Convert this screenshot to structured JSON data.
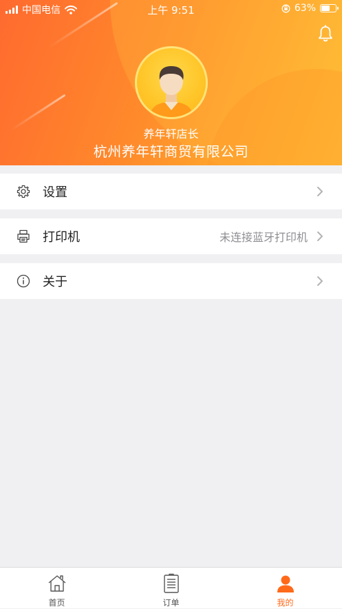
{
  "status_bar": {
    "carrier": "中国电信",
    "time": "上午 9:51",
    "battery": "63%",
    "battery_level": 0.63
  },
  "profile": {
    "role": "养年轩店长",
    "company": "杭州养年轩商贸有限公司",
    "avatar_icon": "person-avatar-icon",
    "notification_icon": "bell-icon"
  },
  "menu": [
    {
      "label": "设置",
      "value": "",
      "icon": "gear-icon"
    },
    {
      "label": "打印机",
      "value": "未连接蓝牙打印机",
      "icon": "printer-icon"
    },
    {
      "label": "关于",
      "value": "",
      "icon": "info-icon"
    }
  ],
  "tabs": [
    {
      "label": "首页",
      "icon": "home-icon",
      "active": false
    },
    {
      "label": "订单",
      "icon": "order-icon",
      "active": false
    },
    {
      "label": "我的",
      "icon": "person-icon",
      "active": true
    }
  ],
  "colors": {
    "accent": "#ff6a1a",
    "header_start": "#ff6a2f",
    "header_end": "#ffc535",
    "background": "#f0f0f2"
  }
}
